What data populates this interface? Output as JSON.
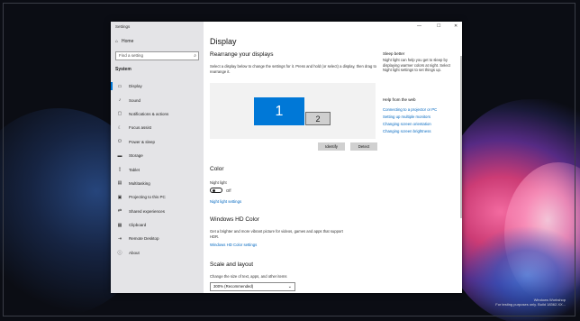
{
  "window": {
    "app_title": "Settings",
    "controls": {
      "minimize": "—",
      "maximize": "☐",
      "close": "✕"
    }
  },
  "sidebar": {
    "home": "Home",
    "search_placeholder": "Find a setting",
    "section": "System",
    "items": [
      {
        "label": "Display",
        "icon": "display-icon",
        "glyph": "▭",
        "active": true
      },
      {
        "label": "Sound",
        "icon": "sound-icon",
        "glyph": "♪",
        "active": false
      },
      {
        "label": "Notifications & actions",
        "icon": "notifications-icon",
        "glyph": "▢",
        "active": false
      },
      {
        "label": "Focus assist",
        "icon": "focus-assist-icon",
        "glyph": "☾",
        "active": false
      },
      {
        "label": "Power & sleep",
        "icon": "power-icon",
        "glyph": "⏻",
        "active": false
      },
      {
        "label": "Storage",
        "icon": "storage-icon",
        "glyph": "▬",
        "active": false
      },
      {
        "label": "Tablet",
        "icon": "tablet-icon",
        "glyph": "▯",
        "active": false
      },
      {
        "label": "Multitasking",
        "icon": "multitasking-icon",
        "glyph": "▤",
        "active": false
      },
      {
        "label": "Projecting to this PC",
        "icon": "projecting-icon",
        "glyph": "▣",
        "active": false
      },
      {
        "label": "Shared experiences",
        "icon": "shared-experiences-icon",
        "glyph": "⇄",
        "active": false
      },
      {
        "label": "Clipboard",
        "icon": "clipboard-icon",
        "glyph": "▦",
        "active": false
      },
      {
        "label": "Remote Desktop",
        "icon": "remote-desktop-icon",
        "glyph": "⇥",
        "active": false
      },
      {
        "label": "About",
        "icon": "about-icon",
        "glyph": "ⓘ",
        "active": false
      }
    ]
  },
  "main": {
    "title": "Display",
    "rearrange": {
      "heading": "Rearrange your displays",
      "description": "Select a display below to change the settings for it. Press and hold (or select) a display, then drag to rearrange it.",
      "monitor_1": "1",
      "monitor_2": "2",
      "identify_label": "Identify",
      "detect_label": "Detect"
    },
    "color": {
      "heading": "Color",
      "night_light_label": "Night light",
      "toggle_state": "Off",
      "night_light_settings": "Night light settings"
    },
    "hdr": {
      "heading": "Windows HD Color",
      "description": "Get a brighter and more vibrant picture for videos, games and apps that support HDR.",
      "link": "Windows HD Color settings"
    },
    "scale": {
      "heading": "Scale and layout",
      "description": "Change the size of text, apps, and other items",
      "selected_value": "300% (Recommended)"
    }
  },
  "right_panel": {
    "sleep_heading": "Sleep better",
    "sleep_text": "Night light can help you get to sleep by displaying warmer colors at night. Select Night light settings to set things up.",
    "help_heading": "Help from the web",
    "links": [
      "Connecting to a projector or PC",
      "Setting up multiple monitors",
      "Changing screen orientation",
      "Changing screen brightness"
    ]
  },
  "desktop": {
    "watermark_line1": "Windows Workshop",
    "watermark_line2": "For testing purposes only. Build 18362.XX..."
  },
  "colors": {
    "accent": "#0078d7",
    "link": "#0067c0",
    "sidebar_bg": "#e4e4e7"
  }
}
